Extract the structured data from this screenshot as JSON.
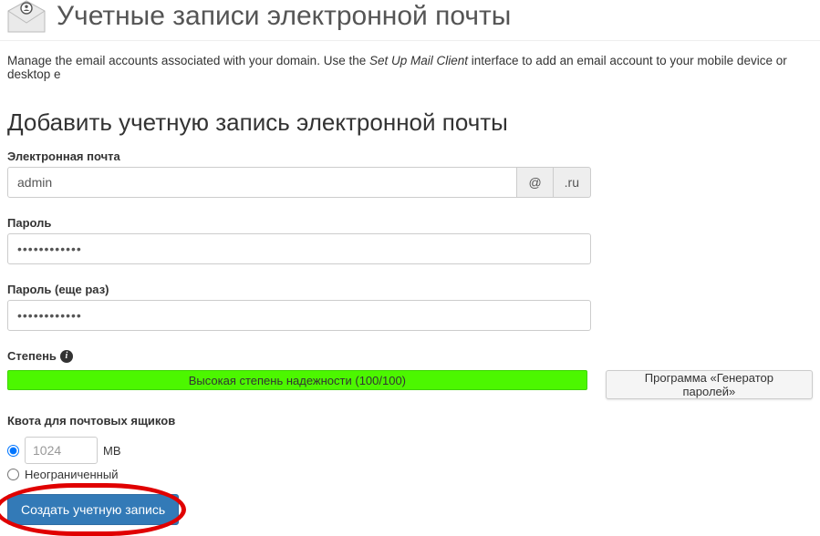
{
  "header": {
    "title": "Учетные записи электронной почты"
  },
  "description": {
    "before": "Manage the email accounts associated with your domain. Use the ",
    "em": "Set Up Mail Client",
    "after": " interface to add an email account to your mobile device or desktop e"
  },
  "add_section": {
    "title": "Добавить учетную запись электронной почты"
  },
  "email": {
    "label": "Электронная почта",
    "value": "admin",
    "at": "@",
    "domain": ".ru"
  },
  "password": {
    "label": "Пароль",
    "value": "••••••••••••"
  },
  "password_confirm": {
    "label": "Пароль (еще раз)",
    "value": "••••••••••••"
  },
  "strength": {
    "label": "Степень",
    "text": "Высокая степень надежности (100/100)"
  },
  "generator": {
    "label": "Программа «Генератор паролей»"
  },
  "quota": {
    "label": "Квота для почтовых ящиков",
    "value": "1024",
    "unit": "MB",
    "unlimited_label": "Неограниченный"
  },
  "submit": {
    "label": "Создать учетную запись"
  }
}
